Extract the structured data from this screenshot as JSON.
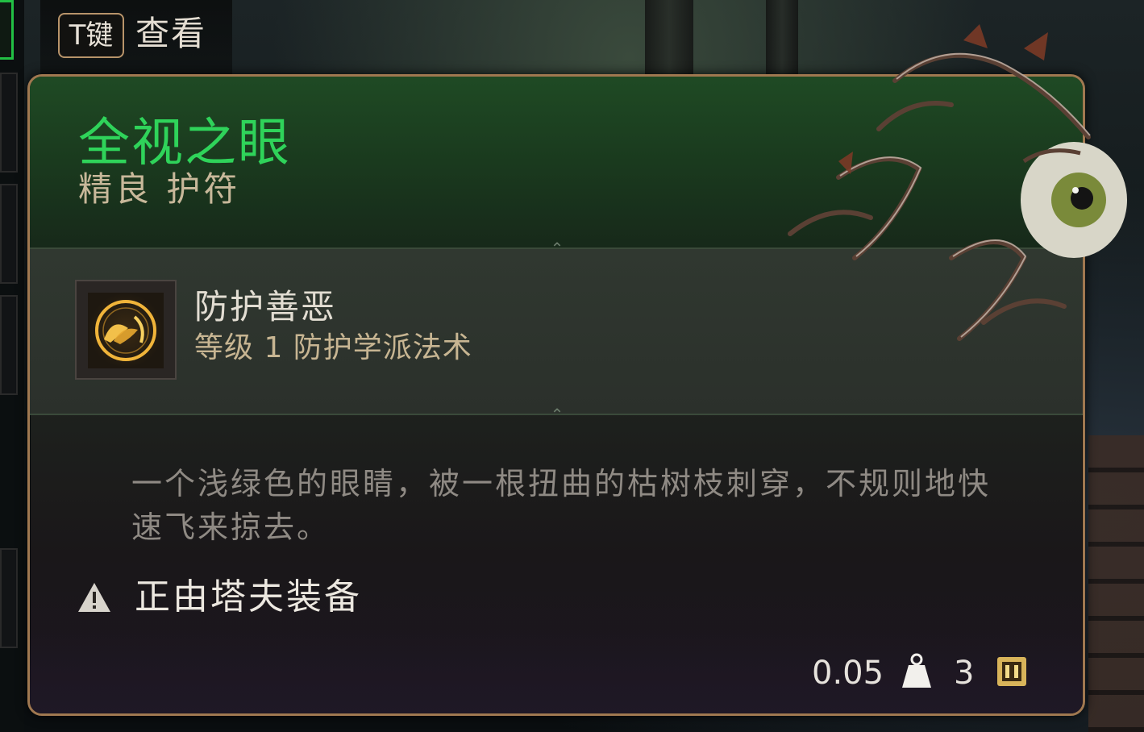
{
  "hint": {
    "key": "T键",
    "action": "查看"
  },
  "item": {
    "name": "全视之眼",
    "rarity_type": "精良 护符",
    "name_color": "#2fd35a"
  },
  "spell": {
    "name": "防护善恶",
    "subtitle": "等级 1 防护学派法术",
    "icon": "winged-sigil-icon"
  },
  "description": "一个浅绿色的眼睛，被一根扭曲的枯树枝刺穿，不规则地快速飞来掠去。",
  "equipped": {
    "text": "正由塔夫装备",
    "icon": "warning-icon"
  },
  "stats": {
    "weight": "0.05",
    "value": "3",
    "weight_icon": "weight-icon",
    "value_icon": "gold-coin-icon"
  }
}
